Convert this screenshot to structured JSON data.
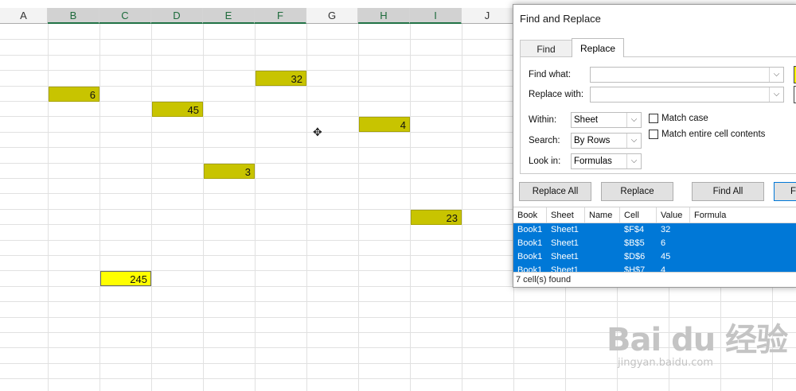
{
  "sheet": {
    "columns": [
      "A",
      "B",
      "C",
      "D",
      "E",
      "F",
      "G",
      "H",
      "I",
      "J"
    ],
    "cells": [
      {
        "col": "F",
        "row": 4,
        "value": "32"
      },
      {
        "col": "B",
        "row": 5,
        "value": "6"
      },
      {
        "col": "D",
        "row": 6,
        "value": "45"
      },
      {
        "col": "H",
        "row": 7,
        "value": "4"
      },
      {
        "col": "E",
        "row": 10,
        "value": "3"
      },
      {
        "col": "I",
        "row": 13,
        "value": "23"
      },
      {
        "col": "C",
        "row": 17,
        "value": "245"
      }
    ],
    "highlight_color": "#c8c400",
    "bright_color": "#ffff00"
  },
  "dialog": {
    "title": "Find and Replace",
    "tabs": {
      "find": "Find",
      "replace": "Replace"
    },
    "find_what_label": "Find what:",
    "replace_with_label": "Replace with:",
    "find_what_value": "",
    "replace_with_value": "",
    "within_label": "Within:",
    "within_value": "Sheet",
    "search_label": "Search:",
    "search_value": "By Rows",
    "look_in_label": "Look in:",
    "look_in_value": "Formulas",
    "match_case": "Match case",
    "match_entire": "Match entire cell contents",
    "buttons": {
      "replace_all": "Replace All",
      "replace": "Replace",
      "find_all": "Find All",
      "find_next": "F"
    },
    "results": {
      "headers": [
        "Book",
        "Sheet",
        "Name",
        "Cell",
        "Value",
        "Formula"
      ],
      "rows": [
        {
          "book": "Book1",
          "sheet": "Sheet1",
          "name": "",
          "cell": "$F$4",
          "value": "32",
          "formula": ""
        },
        {
          "book": "Book1",
          "sheet": "Sheet1",
          "name": "",
          "cell": "$B$5",
          "value": "6",
          "formula": ""
        },
        {
          "book": "Book1",
          "sheet": "Sheet1",
          "name": "",
          "cell": "$D$6",
          "value": "45",
          "formula": ""
        },
        {
          "book": "Book1",
          "sheet": "Sheet1",
          "name": "",
          "cell": "$H$7",
          "value": "4",
          "formula": ""
        }
      ]
    },
    "status": "7 cell(s) found"
  },
  "watermark": {
    "main": "Bai du 经验",
    "sub": "jingyan.baidu.com"
  }
}
